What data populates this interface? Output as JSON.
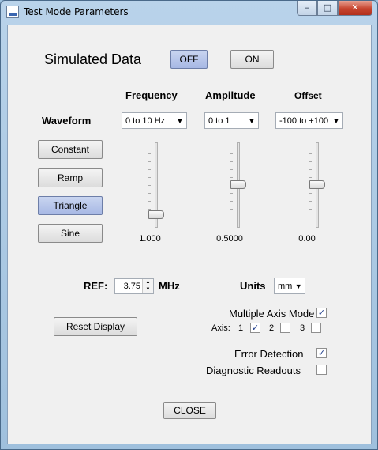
{
  "window": {
    "title": "Test Mode Parameters",
    "min_glyph": "–",
    "max_glyph": "□",
    "close_glyph": "✕"
  },
  "simulated": {
    "label": "Simulated Data",
    "off": "OFF",
    "on": "ON",
    "selected": "OFF"
  },
  "headers": {
    "frequency": "Frequency",
    "amplitude": "Ampiltude",
    "offset": "Offset",
    "waveform": "Waveform"
  },
  "waveform": {
    "buttons": [
      "Constant",
      "Ramp",
      "Triangle",
      "Sine"
    ],
    "selected": "Triangle"
  },
  "combos": {
    "frequency": "0 to 10 Hz",
    "amplitude": "0 to 1",
    "offset": "-100 to +100",
    "units": "mm"
  },
  "sliders": {
    "frequency": {
      "value_text": "1.000",
      "level": 0.1
    },
    "amplitude": {
      "value_text": "0.5000",
      "level": 0.5
    },
    "offset": {
      "value_text": "0.00",
      "level": 0.5
    }
  },
  "ref": {
    "label": "REF:",
    "value": "3.75",
    "unit": "MHz"
  },
  "units_label": "Units",
  "reset_label": "Reset Display",
  "multi_axis": {
    "label": "Multiple Axis Mode",
    "checked": true
  },
  "axis": {
    "label": "Axis:",
    "items": [
      {
        "n": "1",
        "checked": true
      },
      {
        "n": "2",
        "checked": false
      },
      {
        "n": "3",
        "checked": false
      }
    ]
  },
  "error_detection": {
    "label": "Error Detection",
    "checked": true
  },
  "diagnostic": {
    "label": "Diagnostic Readouts",
    "checked": false
  },
  "close_label": "CLOSE",
  "check_glyph": "✓",
  "icons": {
    "app": "app-icon",
    "spin": "spin-arrows-icon",
    "dropdown": "dropdown-arrow-icon"
  }
}
